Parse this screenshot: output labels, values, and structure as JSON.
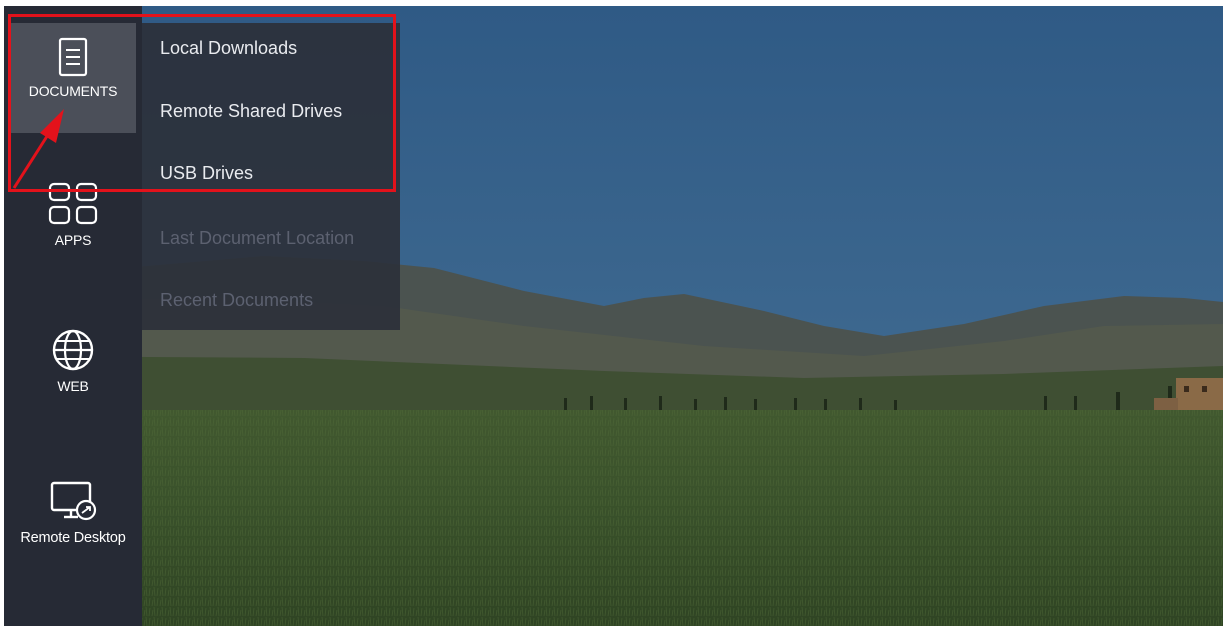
{
  "sidebar": {
    "items": [
      {
        "label": "DOCUMENTS",
        "icon": "document-icon",
        "selected": true
      },
      {
        "label": "APPS",
        "icon": "apps-grid-icon",
        "selected": false
      },
      {
        "label": "WEB",
        "icon": "globe-icon",
        "selected": false
      },
      {
        "label": "Remote Desktop",
        "icon": "remote-desktop-icon",
        "selected": false
      }
    ]
  },
  "flyout": {
    "items": [
      {
        "label": "Local Downloads",
        "enabled": true
      },
      {
        "label": "Remote Shared Drives",
        "enabled": true
      },
      {
        "label": "USB Drives",
        "enabled": true
      },
      {
        "label": "Last Document Location",
        "enabled": false
      },
      {
        "label": "Recent Documents",
        "enabled": false
      }
    ]
  },
  "annotation": {
    "highlight_color": "#e3121b",
    "target": "DOCUMENTS"
  },
  "colors": {
    "sidebar_bg": "#262a35",
    "selected_bg": "#4b4f59",
    "flyout_bg": "#2c303a",
    "disabled_text": "#5c6170"
  }
}
